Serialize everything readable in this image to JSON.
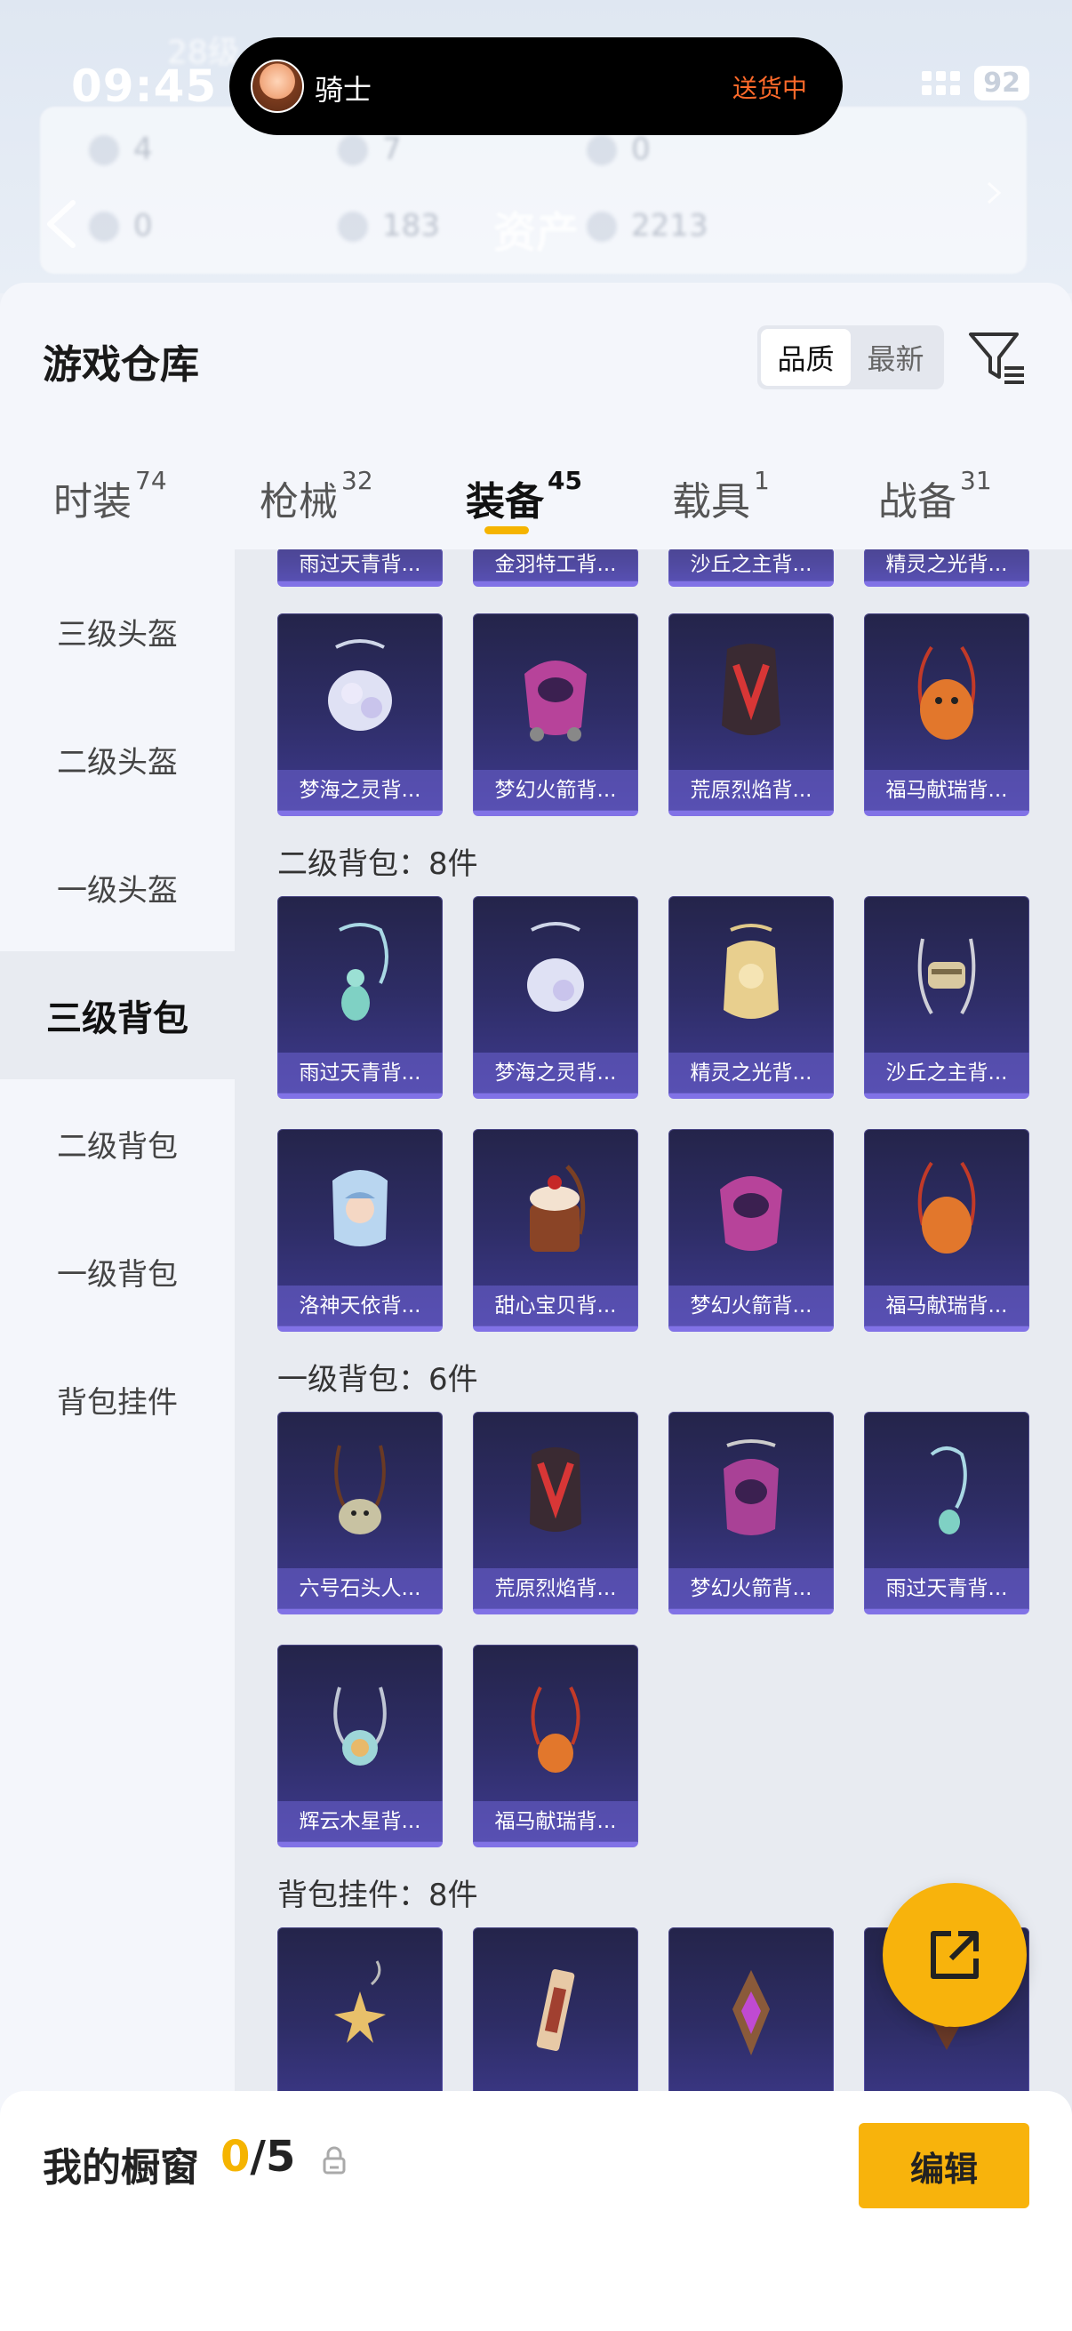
{
  "status_bar": {
    "time": "09:45",
    "battery": "92"
  },
  "island": {
    "name": "骑士",
    "status": "送货中"
  },
  "background": {
    "title": "资产",
    "stats": [
      "4",
      "7",
      "0",
      "0",
      "183",
      "2213"
    ],
    "level": "28级"
  },
  "header": {
    "title": "游戏仓库",
    "sort_options": [
      "品质",
      "最新"
    ],
    "active_sort": "品质"
  },
  "tabs": [
    {
      "label": "时装",
      "count": "74"
    },
    {
      "label": "枪械",
      "count": "32"
    },
    {
      "label": "装备",
      "count": "45"
    },
    {
      "label": "载具",
      "count": "1"
    },
    {
      "label": "战备",
      "count": "31"
    }
  ],
  "active_tab": "装备",
  "sidebar": {
    "items": [
      "三级头盔",
      "二级头盔",
      "一级头盔",
      "三级背包",
      "二级背包",
      "一级背包",
      "背包挂件"
    ],
    "active": "三级背包"
  },
  "sections": {
    "level3_backpack": {
      "partial_row": [
        "雨过天青背...",
        "金羽特工背...",
        "沙丘之主背...",
        "精灵之光背..."
      ],
      "row2": [
        "梦海之灵背...",
        "梦幻火箭背...",
        "荒原烈焰背...",
        "福马献瑞背..."
      ]
    },
    "level2_backpack": {
      "title": "二级背包：8件",
      "row1": [
        "雨过天青背...",
        "梦海之灵背...",
        "精灵之光背...",
        "沙丘之主背..."
      ],
      "row2": [
        "洛神天依背...",
        "甜心宝贝背...",
        "梦幻火箭背...",
        "福马献瑞背..."
      ]
    },
    "level1_backpack": {
      "title": "一级背包：6件",
      "row1": [
        "六号石头人...",
        "荒原烈焰背...",
        "梦幻火箭背...",
        "雨过天青背..."
      ],
      "row2": [
        "辉云木星背...",
        "福马献瑞背..."
      ]
    },
    "pendant": {
      "title": "背包挂件：8件"
    }
  },
  "bottom": {
    "label": "我的橱窗",
    "current": "0",
    "total": "/5",
    "edit_label": "编辑"
  },
  "colors": {
    "accent": "#f5b400",
    "card_bg": "#2e2d66",
    "card_border": "#8172e6"
  }
}
